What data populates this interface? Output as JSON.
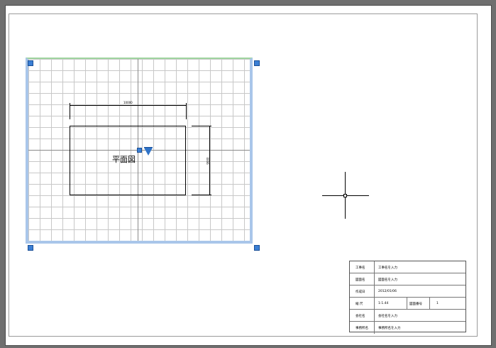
{
  "drawing": {
    "room_label": "平面図",
    "dim_width_text": "10000",
    "dim_height_text": "9000"
  },
  "title_block": {
    "rows": [
      {
        "label": "工事名",
        "value": "工事名を入力"
      },
      {
        "label": "図面名",
        "value": "図面名を入力"
      },
      {
        "label": "作成日",
        "value": "2012/01/06"
      },
      {
        "label": "縮 尺",
        "value": "1:1.44",
        "extra_label": "図面番号",
        "extra_value": "1"
      },
      {
        "label": "会社名",
        "value": "会社名を入力"
      },
      {
        "label": "事務所名",
        "value": "事務所名を入力"
      }
    ]
  },
  "colors": {
    "background": "#6f6f6f",
    "viewport_frame": "#a9c6ea",
    "grip": "#3b7fd4"
  },
  "icons": {
    "grip": "blue-square-grip",
    "triangle": "blue-down-triangle",
    "cursor": "crosshair-cursor"
  }
}
